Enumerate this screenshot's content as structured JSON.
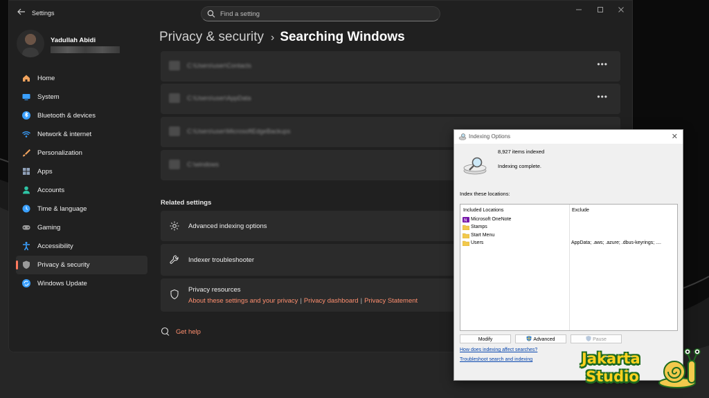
{
  "window": {
    "app_title": "Settings",
    "search_placeholder": "Find a setting"
  },
  "profile": {
    "name": "Yadullah Abidi"
  },
  "sidebar": {
    "items": [
      {
        "label": "Home",
        "icon": "home-icon",
        "color": "#f0a35e"
      },
      {
        "label": "System",
        "icon": "system-icon",
        "color": "#3aa0ff"
      },
      {
        "label": "Bluetooth & devices",
        "icon": "bluetooth-icon",
        "color": "#3aa0ff"
      },
      {
        "label": "Network & internet",
        "icon": "network-icon",
        "color": "#3aa0ff"
      },
      {
        "label": "Personalization",
        "icon": "personalization-icon",
        "color": "#f0a35e"
      },
      {
        "label": "Apps",
        "icon": "apps-icon",
        "color": "#8fa0b8"
      },
      {
        "label": "Accounts",
        "icon": "accounts-icon",
        "color": "#2ec4a5"
      },
      {
        "label": "Time & language",
        "icon": "time-language-icon",
        "color": "#3aa0ff"
      },
      {
        "label": "Gaming",
        "icon": "gaming-icon",
        "color": "#9a9a9a"
      },
      {
        "label": "Accessibility",
        "icon": "accessibility-icon",
        "color": "#3aa0ff"
      },
      {
        "label": "Privacy & security",
        "icon": "shield-icon",
        "color": "#9a9a9a",
        "active": true
      },
      {
        "label": "Windows Update",
        "icon": "windows-update-icon",
        "color": "#3aa0ff"
      }
    ]
  },
  "breadcrumb": {
    "parent": "Privacy & security",
    "separator": "›",
    "current": "Searching Windows"
  },
  "locations": [
    {
      "path": "C:\\Users\\user\\Contacts"
    },
    {
      "path": "C:\\Users\\user\\AppData"
    },
    {
      "path": "C:\\Users\\user\\MicrosoftEdgeBackups"
    },
    {
      "path": "C:\\windows"
    }
  ],
  "related": {
    "heading": "Related settings",
    "advanced": "Advanced indexing options",
    "troubleshooter": "Indexer troubleshooter",
    "privacy_title": "Privacy resources",
    "privacy_links": [
      "About these settings and your privacy",
      "Privacy dashboard",
      "Privacy Statement"
    ],
    "link_separator": "|",
    "help": "Get help"
  },
  "dialog": {
    "title": "Indexing Options",
    "items_indexed": "8,927 items indexed",
    "status": "Indexing complete.",
    "index_these": "Index these locations:",
    "col_included": "Included Locations",
    "col_exclude": "Exclude",
    "rows": [
      {
        "name": "Microsoft OneNote",
        "exclude": "",
        "icon": "onenote-icon"
      },
      {
        "name": "Stamps",
        "exclude": "",
        "icon": "folder-icon"
      },
      {
        "name": "Start Menu",
        "exclude": "",
        "icon": "folder-icon"
      },
      {
        "name": "Users",
        "exclude": "AppData; .aws; .azure; .dbus-keyrings; ....",
        "icon": "folder-icon"
      }
    ],
    "buttons": {
      "modify": "Modify",
      "advanced": "Advanced",
      "pause": "Pause"
    },
    "link_affect": "How does indexing affect searches?",
    "link_troubleshoot": "Troubleshoot search and indexing"
  },
  "watermark": {
    "line1": "Jakarta",
    "line2": "Studio"
  },
  "colors": {
    "accent": "#ff8f6f",
    "window_bg": "#202020",
    "card_bg": "#2b2b2b",
    "dialog_bg": "#f0f0f0"
  }
}
